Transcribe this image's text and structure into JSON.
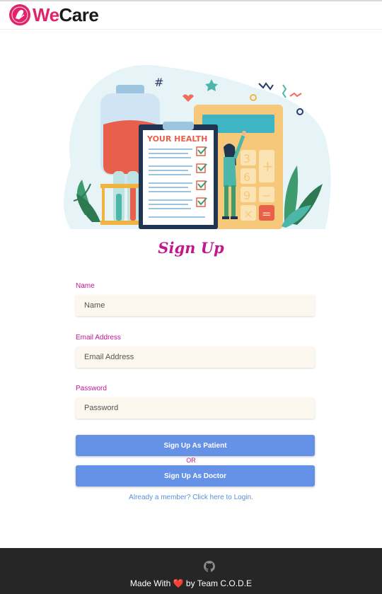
{
  "app": {
    "logo_we": "We",
    "logo_care": "Care",
    "logo_icon": "wecare-logo-icon"
  },
  "hero": {
    "clipboard_heading": "YOUR HEALTH",
    "icon": "health-illustration"
  },
  "form": {
    "title": "Sign Up",
    "name": {
      "label": "Name",
      "placeholder": "Name",
      "value": ""
    },
    "email": {
      "label": "Email Address",
      "placeholder": "Email Address",
      "value": ""
    },
    "password": {
      "label": "Password",
      "placeholder": "Password",
      "value": ""
    },
    "patient_button": "Sign Up As Patient",
    "or_text": "OR",
    "doctor_button": "Sign Up As Doctor",
    "login_link": "Already a member? Click here to Login."
  },
  "footer": {
    "made_with": "Made With",
    "by_team": "by Team C.O.D.E",
    "heart_icon": "heart-icon",
    "github_icon": "github-icon"
  },
  "colors": {
    "accent": "#c2178f",
    "brand": "#e0246c",
    "button": "#6591e6",
    "footer_bg": "#262626",
    "input_bg": "#fcf7ef"
  }
}
